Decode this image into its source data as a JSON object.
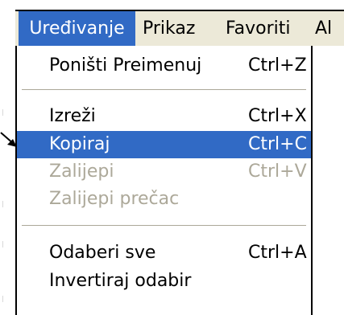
{
  "menubar": {
    "items": [
      {
        "label": "Uređivanje",
        "active": true
      },
      {
        "label": "Prikaz",
        "active": false
      },
      {
        "label": "Favoriti",
        "active": false
      },
      {
        "label": "Al",
        "active": false
      }
    ]
  },
  "dropdown": {
    "items": [
      {
        "label": "Poništi Preimenuj",
        "shortcut": "Ctrl+Z",
        "state": "enabled"
      },
      {
        "label": "Izreži",
        "shortcut": "Ctrl+X",
        "state": "enabled"
      },
      {
        "label": "Kopiraj",
        "shortcut": "Ctrl+C",
        "state": "highlighted"
      },
      {
        "label": "Zalijepi",
        "shortcut": "Ctrl+V",
        "state": "disabled"
      },
      {
        "label": "Zalijepi prečac",
        "shortcut": "",
        "state": "disabled"
      },
      {
        "label": "Odaberi sve",
        "shortcut": "Ctrl+A",
        "state": "enabled"
      },
      {
        "label": "Invertiraj odabir",
        "shortcut": "",
        "state": "enabled"
      }
    ]
  },
  "pointer": {
    "icon": "arrow-pointer-icon"
  },
  "colors": {
    "highlight": "#316ac5",
    "highlight_text": "#ffffff",
    "disabled_text": "#aca899",
    "menubar_bg": "#ece9d8",
    "separator": "#aca899"
  }
}
